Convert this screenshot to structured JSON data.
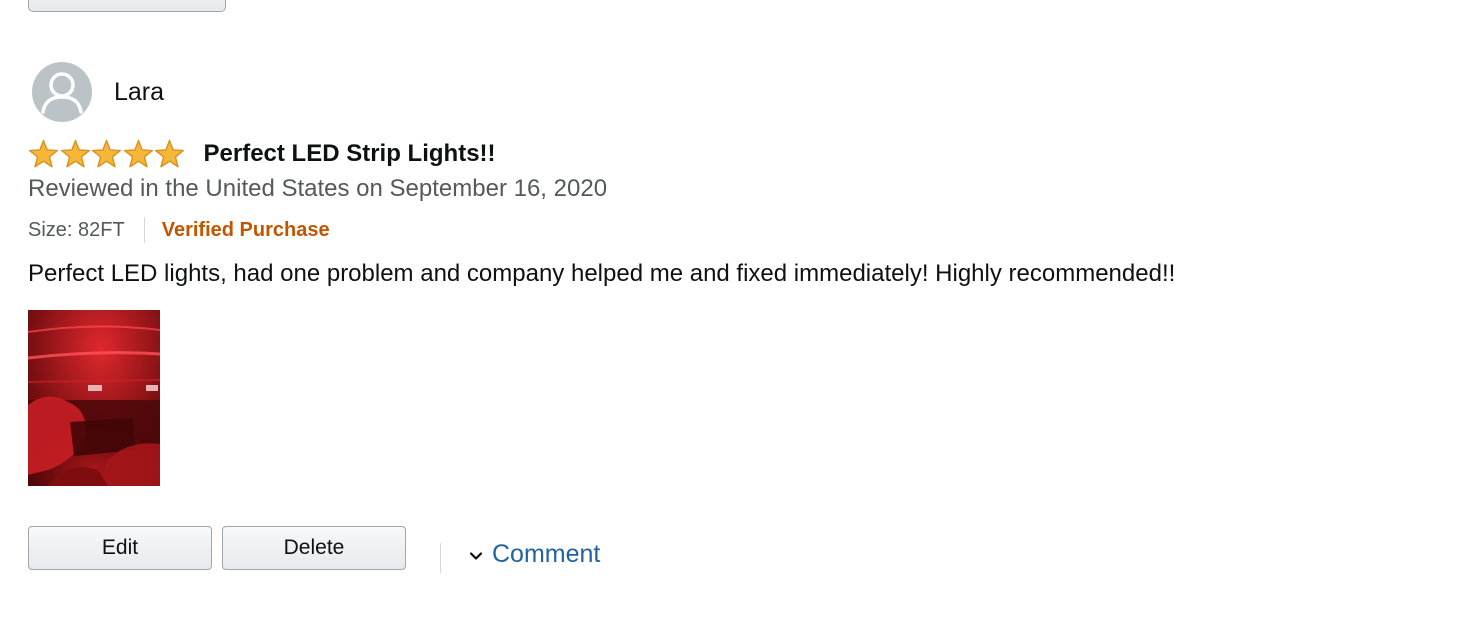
{
  "review": {
    "profile_name": "Lara",
    "rating": 5,
    "rating_max": 5,
    "title": "Perfect LED Strip Lights!!",
    "date_line": "Reviewed in the United States on September 16, 2020",
    "size_label": "Size: 82FT",
    "verified_label": "Verified Purchase",
    "body": "Perfect LED lights, had one problem and company helped me and fixed immediately! Highly recommended!!"
  },
  "actions": {
    "edit_label": "Edit",
    "delete_label": "Delete",
    "comment_label": "Comment"
  },
  "icons": {
    "avatar": "default-user-avatar-icon",
    "star": "filled-star-icon",
    "comment_toggle": "chevron-down-icon"
  },
  "colors": {
    "star_fill": "#f4b73a",
    "star_stroke": "#d9911c",
    "verified": "#c45500",
    "link": "#2162a1",
    "muted_text": "#565959"
  }
}
